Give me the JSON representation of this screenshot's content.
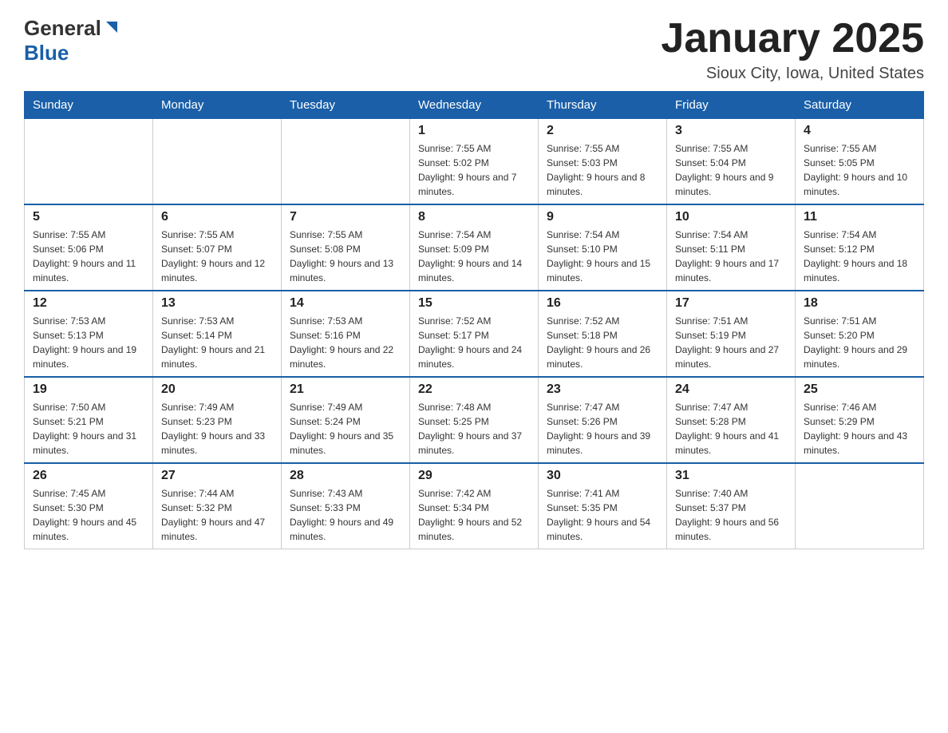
{
  "logo": {
    "general": "General",
    "blue": "Blue"
  },
  "title": "January 2025",
  "location": "Sioux City, Iowa, United States",
  "weekdays": [
    "Sunday",
    "Monday",
    "Tuesday",
    "Wednesday",
    "Thursday",
    "Friday",
    "Saturday"
  ],
  "weeks": [
    [
      {
        "day": "",
        "info": ""
      },
      {
        "day": "",
        "info": ""
      },
      {
        "day": "",
        "info": ""
      },
      {
        "day": "1",
        "info": "Sunrise: 7:55 AM\nSunset: 5:02 PM\nDaylight: 9 hours and 7 minutes."
      },
      {
        "day": "2",
        "info": "Sunrise: 7:55 AM\nSunset: 5:03 PM\nDaylight: 9 hours and 8 minutes."
      },
      {
        "day": "3",
        "info": "Sunrise: 7:55 AM\nSunset: 5:04 PM\nDaylight: 9 hours and 9 minutes."
      },
      {
        "day": "4",
        "info": "Sunrise: 7:55 AM\nSunset: 5:05 PM\nDaylight: 9 hours and 10 minutes."
      }
    ],
    [
      {
        "day": "5",
        "info": "Sunrise: 7:55 AM\nSunset: 5:06 PM\nDaylight: 9 hours and 11 minutes."
      },
      {
        "day": "6",
        "info": "Sunrise: 7:55 AM\nSunset: 5:07 PM\nDaylight: 9 hours and 12 minutes."
      },
      {
        "day": "7",
        "info": "Sunrise: 7:55 AM\nSunset: 5:08 PM\nDaylight: 9 hours and 13 minutes."
      },
      {
        "day": "8",
        "info": "Sunrise: 7:54 AM\nSunset: 5:09 PM\nDaylight: 9 hours and 14 minutes."
      },
      {
        "day": "9",
        "info": "Sunrise: 7:54 AM\nSunset: 5:10 PM\nDaylight: 9 hours and 15 minutes."
      },
      {
        "day": "10",
        "info": "Sunrise: 7:54 AM\nSunset: 5:11 PM\nDaylight: 9 hours and 17 minutes."
      },
      {
        "day": "11",
        "info": "Sunrise: 7:54 AM\nSunset: 5:12 PM\nDaylight: 9 hours and 18 minutes."
      }
    ],
    [
      {
        "day": "12",
        "info": "Sunrise: 7:53 AM\nSunset: 5:13 PM\nDaylight: 9 hours and 19 minutes."
      },
      {
        "day": "13",
        "info": "Sunrise: 7:53 AM\nSunset: 5:14 PM\nDaylight: 9 hours and 21 minutes."
      },
      {
        "day": "14",
        "info": "Sunrise: 7:53 AM\nSunset: 5:16 PM\nDaylight: 9 hours and 22 minutes."
      },
      {
        "day": "15",
        "info": "Sunrise: 7:52 AM\nSunset: 5:17 PM\nDaylight: 9 hours and 24 minutes."
      },
      {
        "day": "16",
        "info": "Sunrise: 7:52 AM\nSunset: 5:18 PM\nDaylight: 9 hours and 26 minutes."
      },
      {
        "day": "17",
        "info": "Sunrise: 7:51 AM\nSunset: 5:19 PM\nDaylight: 9 hours and 27 minutes."
      },
      {
        "day": "18",
        "info": "Sunrise: 7:51 AM\nSunset: 5:20 PM\nDaylight: 9 hours and 29 minutes."
      }
    ],
    [
      {
        "day": "19",
        "info": "Sunrise: 7:50 AM\nSunset: 5:21 PM\nDaylight: 9 hours and 31 minutes."
      },
      {
        "day": "20",
        "info": "Sunrise: 7:49 AM\nSunset: 5:23 PM\nDaylight: 9 hours and 33 minutes."
      },
      {
        "day": "21",
        "info": "Sunrise: 7:49 AM\nSunset: 5:24 PM\nDaylight: 9 hours and 35 minutes."
      },
      {
        "day": "22",
        "info": "Sunrise: 7:48 AM\nSunset: 5:25 PM\nDaylight: 9 hours and 37 minutes."
      },
      {
        "day": "23",
        "info": "Sunrise: 7:47 AM\nSunset: 5:26 PM\nDaylight: 9 hours and 39 minutes."
      },
      {
        "day": "24",
        "info": "Sunrise: 7:47 AM\nSunset: 5:28 PM\nDaylight: 9 hours and 41 minutes."
      },
      {
        "day": "25",
        "info": "Sunrise: 7:46 AM\nSunset: 5:29 PM\nDaylight: 9 hours and 43 minutes."
      }
    ],
    [
      {
        "day": "26",
        "info": "Sunrise: 7:45 AM\nSunset: 5:30 PM\nDaylight: 9 hours and 45 minutes."
      },
      {
        "day": "27",
        "info": "Sunrise: 7:44 AM\nSunset: 5:32 PM\nDaylight: 9 hours and 47 minutes."
      },
      {
        "day": "28",
        "info": "Sunrise: 7:43 AM\nSunset: 5:33 PM\nDaylight: 9 hours and 49 minutes."
      },
      {
        "day": "29",
        "info": "Sunrise: 7:42 AM\nSunset: 5:34 PM\nDaylight: 9 hours and 52 minutes."
      },
      {
        "day": "30",
        "info": "Sunrise: 7:41 AM\nSunset: 5:35 PM\nDaylight: 9 hours and 54 minutes."
      },
      {
        "day": "31",
        "info": "Sunrise: 7:40 AM\nSunset: 5:37 PM\nDaylight: 9 hours and 56 minutes."
      },
      {
        "day": "",
        "info": ""
      }
    ]
  ]
}
